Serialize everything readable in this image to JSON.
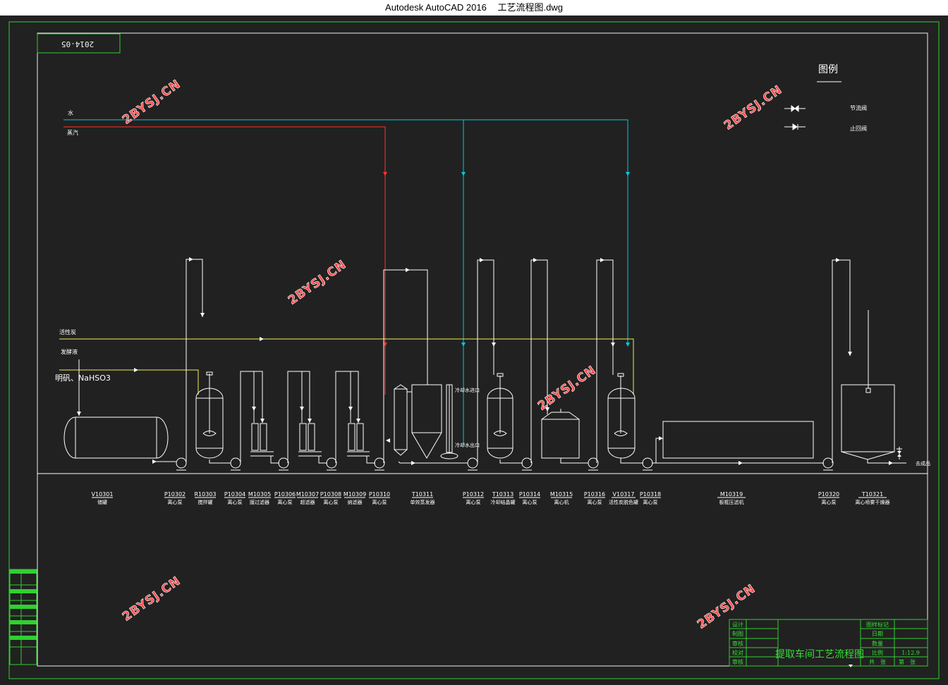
{
  "window": {
    "app": "Autodesk AutoCAD 2016",
    "file": "工艺流程图.dwg"
  },
  "date_stamp": "2014-05",
  "legend": {
    "title": "图例",
    "items": [
      "节流阀",
      "止回阀"
    ]
  },
  "utility_lines": {
    "water": "水",
    "steam": "蒸汽"
  },
  "feed_lines": {
    "activated_carbon": "活性炭",
    "fermentation_broth": "发酵液",
    "alum": "明矾、NaHSO3"
  },
  "nozzle_labels": {
    "cooling_in": "冷却水进口",
    "cooling_out": "冷却水出口"
  },
  "outlet_label": "去成品",
  "equipment": [
    {
      "code": "V10301",
      "name": "储罐"
    },
    {
      "code": "P10302",
      "name": "离心泵"
    },
    {
      "code": "R10303",
      "name": "搅拌罐"
    },
    {
      "code": "P10304",
      "name": "离心泵"
    },
    {
      "code": "M10305",
      "name": "膜过滤器"
    },
    {
      "code": "P10306",
      "name": "离心泵"
    },
    {
      "code": "M10307",
      "name": "超滤器"
    },
    {
      "code": "P10308",
      "name": "离心泵"
    },
    {
      "code": "M10309",
      "name": "纳滤器"
    },
    {
      "code": "P10310",
      "name": "离心泵"
    },
    {
      "code": "T10311",
      "name": "单效蒸发器"
    },
    {
      "code": "P10312",
      "name": "离心泵"
    },
    {
      "code": "T10313",
      "name": "冷却结晶罐"
    },
    {
      "code": "P10314",
      "name": "离心泵"
    },
    {
      "code": "M10315",
      "name": "离心机"
    },
    {
      "code": "P10316",
      "name": "离心泵"
    },
    {
      "code": "V10317",
      "name": "活性炭脱色罐"
    },
    {
      "code": "P10318",
      "name": "离心泵"
    },
    {
      "code": "M10319",
      "name": "板框压滤机"
    },
    {
      "code": "P10320",
      "name": "离心泵"
    },
    {
      "code": "T10321",
      "name": "离心喷雾干燥器"
    }
  ],
  "title_block": {
    "drawing_title": "提取车间工艺流程图",
    "left_labels": [
      "设计",
      "制图",
      "审核",
      "校对",
      "审核"
    ],
    "right_labels": [
      "图样标记",
      "日期",
      "数量",
      "比例",
      "1:12.9"
    ],
    "footer": [
      "共",
      "张",
      "第",
      "张"
    ]
  },
  "watermark": "2BYSJ.CN",
  "colors": {
    "water": "#00c8e0",
    "steam": "#ff3030",
    "feed": "#f0f050",
    "frame": "#30d030",
    "pipe": "#ffffff"
  }
}
